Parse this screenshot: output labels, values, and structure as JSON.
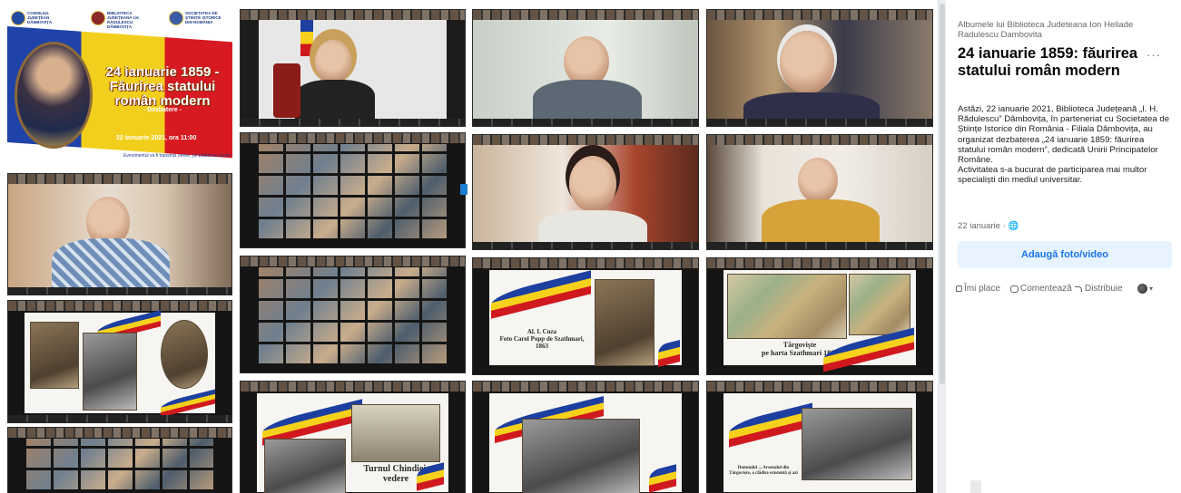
{
  "poster": {
    "title": "24 ianuarie 1859 - Făurirea statului român modern",
    "subtitle": "- Dezbatere -",
    "date": "22 ianuarie 2021, ora 11:00",
    "footer": "Evenimentul va fi transmis online, pe platforma Zoom",
    "logos": [
      "CONSILIUL JUDEȚEAN DÂMBOVIȚA",
      "BIBLIOTECA JUDEȚEANĂ I.H. RĂDULESCU DÂMBOVIȚA",
      "SOCIETATEA DE ȘTIINȚE ISTORICE DIN ROMÂNIA"
    ]
  },
  "slides": {
    "cuza_caption": "Al. I. Cuza\nFoto Carol Popp de Szathmari, 1863",
    "targoviste_caption": "Târgoviște\npe harta Szathmari 1864",
    "bottom_center_caption": "Turnul Chindiei, vedere",
    "bottom_right_caption": "Domnului ... Arsenalul din Târgoviște, o clădire existentă și azi"
  },
  "panel": {
    "album_title": "Albumele lui Biblioteca Judeteana Ion Heliade Radulescu Dambovita",
    "post_title": "24 ianuarie 1859: făurirea statului român modern",
    "body_lines": [
      "Astăzi, 22 ianuarie 2021, Biblioteca Județeană „I. H. Rădulescu” Dâmbovița, în parteneriat cu Societatea de Științe Istorice din România - Filiala Dâmbovița, au organizat dezbaterea „24 ianuarie 1859: făurirea statului român modern”, dedicată Unirii Principatelor Române.",
      "Activitatea s-a bucurat de participarea mai multor specialiști din mediul universitar."
    ],
    "date": "22 ianuarie · 🌐",
    "add_media": "Adaugă foto/video",
    "actions": {
      "like": "Îmi place",
      "comment": "Comentează",
      "share": "Distribuie"
    },
    "more": "···"
  },
  "colors": {
    "accent": "#1b74e4",
    "add_bg": "#e7f3ff",
    "flag_blue": "#1d3fa0",
    "flag_yellow": "#f6d11b",
    "flag_red": "#d0191f"
  }
}
